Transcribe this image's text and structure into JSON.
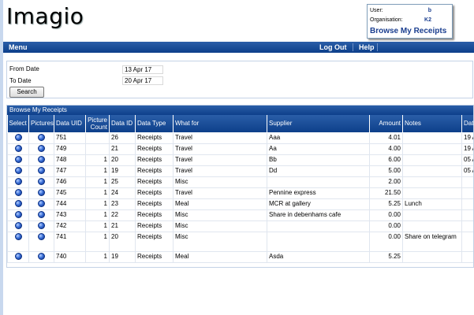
{
  "app": {
    "logo": "Imagio"
  },
  "user_box": {
    "user_label": "User:",
    "user_value": "b",
    "org_label": "Organisation:",
    "org_value": "K2",
    "browse_link": "Browse My Receipts"
  },
  "menubar": {
    "menu": "Menu",
    "logout": "Log Out",
    "help": "Help"
  },
  "filter": {
    "from_label": "From Date",
    "from_value": "13 Apr 17",
    "to_label": "To Date",
    "to_value": "20 Apr 17",
    "search_label": "Search"
  },
  "results": {
    "title": "Browse My Receipts",
    "columns": [
      "Select",
      "Pictures",
      "Data UID",
      "Picture Count",
      "Data ID",
      "Data Type",
      "What for",
      "Supplier",
      "Amount",
      "Notes",
      "Dat"
    ],
    "rows": [
      {
        "uid": "751",
        "count": "",
        "data_id": "26",
        "type": "Receipts",
        "what_for": "Travel",
        "supplier": "Aaa",
        "amount": "4.01",
        "notes": "",
        "date": "19 A"
      },
      {
        "uid": "749",
        "count": "",
        "data_id": "21",
        "type": "Receipts",
        "what_for": "Travel",
        "supplier": "Aa",
        "amount": "4.00",
        "notes": "",
        "date": "19 A"
      },
      {
        "uid": "748",
        "count": "1",
        "data_id": "20",
        "type": "Receipts",
        "what_for": "Travel",
        "supplier": "Bb",
        "amount": "6.00",
        "notes": "",
        "date": "05 A"
      },
      {
        "uid": "747",
        "count": "1",
        "data_id": "19",
        "type": "Receipts",
        "what_for": "Travel",
        "supplier": "Dd",
        "amount": "5.00",
        "notes": "",
        "date": "05 A"
      },
      {
        "uid": "746",
        "count": "1",
        "data_id": "25",
        "type": "Receipts",
        "what_for": "Misc",
        "supplier": "",
        "amount": "2.00",
        "notes": "",
        "date": ""
      },
      {
        "uid": "745",
        "count": "1",
        "data_id": "24",
        "type": "Receipts",
        "what_for": "Travel",
        "supplier": "Pennine express",
        "amount": "21.50",
        "notes": "",
        "date": ""
      },
      {
        "uid": "744",
        "count": "1",
        "data_id": "23",
        "type": "Receipts",
        "what_for": "Meal",
        "supplier": "MCR at gallery",
        "amount": "5.25",
        "notes": "Lunch",
        "date": ""
      },
      {
        "uid": "743",
        "count": "1",
        "data_id": "22",
        "type": "Receipts",
        "what_for": "Misc",
        "supplier": "Share in debenhams cafe",
        "amount": "0.00",
        "notes": "",
        "date": ""
      },
      {
        "uid": "742",
        "count": "1",
        "data_id": "21",
        "type": "Receipts",
        "what_for": "Misc",
        "supplier": "",
        "amount": "0.00",
        "notes": "",
        "date": ""
      },
      {
        "uid": "741",
        "count": "1",
        "data_id": "20",
        "type": "Receipts",
        "what_for": "Misc",
        "supplier": "",
        "amount": "0.00",
        "notes": "Share on telegram",
        "date": ""
      },
      {
        "uid": "740",
        "count": "1",
        "data_id": "19",
        "type": "Receipts",
        "what_for": "Meal",
        "supplier": "Asda",
        "amount": "5.25",
        "notes": "",
        "date": ""
      }
    ]
  }
}
